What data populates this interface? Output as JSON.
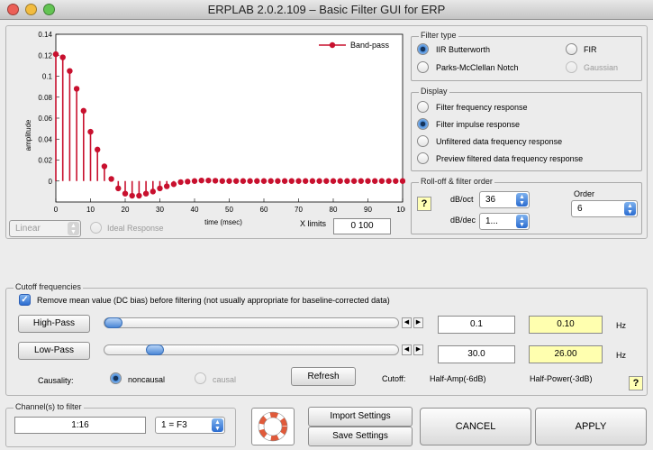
{
  "window": {
    "title": "ERPLAB 2.0.2.109   –   Basic Filter GUI for ERP"
  },
  "plot": {
    "y_tick_labels": [
      "0.14",
      "0.12",
      "0.1",
      "0.08",
      "0.06",
      "0.04",
      "0.02",
      "0"
    ],
    "x_tick_labels": [
      "0",
      "10",
      "20",
      "30",
      "40",
      "50",
      "60",
      "70",
      "80",
      "90",
      "100"
    ],
    "ylabel": "amplitude",
    "xlabel": "time (msec)",
    "legend": "Band-pass",
    "x_limits_label": "X limits",
    "x_limits_value": "0  100",
    "scale_value": "Linear",
    "ideal_response_label": "Ideal Response"
  },
  "chart_data": {
    "type": "stem",
    "xlabel": "time (msec)",
    "ylabel": "amplitude",
    "xlim": [
      0,
      100
    ],
    "ylim": [
      -0.02,
      0.14
    ],
    "series": [
      {
        "name": "Band-pass",
        "color": "#c8102e",
        "x": [
          0,
          2,
          4,
          6,
          8,
          10,
          12,
          14,
          16,
          18,
          20,
          22,
          24,
          26,
          28,
          30,
          32,
          34,
          36,
          38,
          40,
          42,
          44,
          46,
          48,
          50,
          52,
          54,
          56,
          58,
          60,
          62,
          64,
          66,
          68,
          70,
          72,
          74,
          76,
          78,
          80,
          82,
          84,
          86,
          88,
          90,
          92,
          94,
          96,
          98,
          100
        ],
        "values": [
          0.121,
          0.118,
          0.105,
          0.088,
          0.067,
          0.047,
          0.03,
          0.014,
          0.002,
          -0.007,
          -0.012,
          -0.014,
          -0.014,
          -0.012,
          -0.01,
          -0.007,
          -0.005,
          -0.003,
          -0.001,
          -0.0005,
          0,
          0.0005,
          0.0005,
          0.0003,
          0,
          0,
          0,
          0,
          0,
          0,
          0,
          0,
          0,
          0,
          0,
          0,
          0,
          0,
          0,
          0,
          0,
          0,
          0,
          0,
          0,
          0,
          0,
          0,
          0,
          0,
          0
        ]
      }
    ]
  },
  "filter_type": {
    "title": "Filter type",
    "iir": "IIR Butterworth",
    "fir": "FIR",
    "pm": "Parks-McClellan Notch",
    "gaussian": "Gaussian"
  },
  "display": {
    "title": "Display",
    "opt1": "Filter frequency response",
    "opt2": "Filter impulse response",
    "opt3": "Unfiltered data frequency response",
    "opt4": "Preview filtered data frequency response"
  },
  "rolloff": {
    "title": "Roll-off & filter order",
    "dboct_label": "dB/oct",
    "dboct_value": "36",
    "dbdec_label": "dB/dec",
    "dbdec_value": "1...",
    "order_label": "Order",
    "order_value": "6",
    "help": "?"
  },
  "cutoff": {
    "title": "Cutoff frequencies",
    "dc_label": "Remove mean value (DC bias) before filtering (not usually appropriate for baseline-corrected data)",
    "highpass_label": "High-Pass",
    "highpass_value": "0.1",
    "highpass_power": "0.10",
    "highpass_position": 0,
    "lowpass_label": "Low-Pass",
    "lowpass_value": "30.0",
    "lowpass_power": "26.00",
    "lowpass_position": 0.15,
    "hz": "Hz",
    "causality_label": "Causality:",
    "noncausal": "noncausal",
    "causal": "causal",
    "refresh": "Refresh",
    "cutoff_label": "Cutoff:",
    "half_amp": "Half-Amp(-6dB)",
    "half_power": "Half-Power(-3dB)",
    "help": "?"
  },
  "channels": {
    "title": "Channel(s) to filter",
    "value": "1:16",
    "dropdown": "1 = F3"
  },
  "actions": {
    "import": "Import Settings",
    "save": "Save Settings",
    "cancel": "CANCEL",
    "apply": "APPLY"
  }
}
